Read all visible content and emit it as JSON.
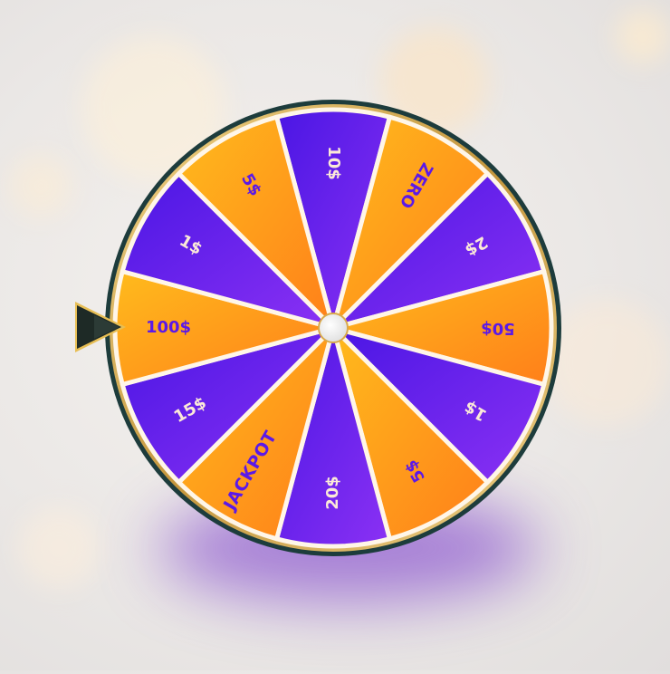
{
  "game": {
    "pointer_icon": "play-arrow-pointer",
    "colors": {
      "purple_dark": "#4a16e4",
      "purple_light": "#8b31f4",
      "orange_light": "#ffbb1c",
      "orange_dark": "#ff7f1a",
      "purple_text": "#5b19e8",
      "white_text": "#fbe9d8",
      "rim_gold": "#d3a84b",
      "rim_dark": "#1d3c3c"
    },
    "segments": [
      {
        "label": "10$",
        "color": "purple"
      },
      {
        "label": "ZERO",
        "color": "orange"
      },
      {
        "label": "2$",
        "color": "purple"
      },
      {
        "label": "50$",
        "color": "orange"
      },
      {
        "label": "1$",
        "color": "purple"
      },
      {
        "label": "5$",
        "color": "orange"
      },
      {
        "label": "20$",
        "color": "purple"
      },
      {
        "label": "JACKPOT",
        "color": "orange"
      },
      {
        "label": "15$",
        "color": "purple"
      },
      {
        "label": "100$",
        "color": "orange"
      },
      {
        "label": "1$",
        "color": "purple"
      },
      {
        "label": "5$",
        "color": "orange"
      }
    ]
  }
}
